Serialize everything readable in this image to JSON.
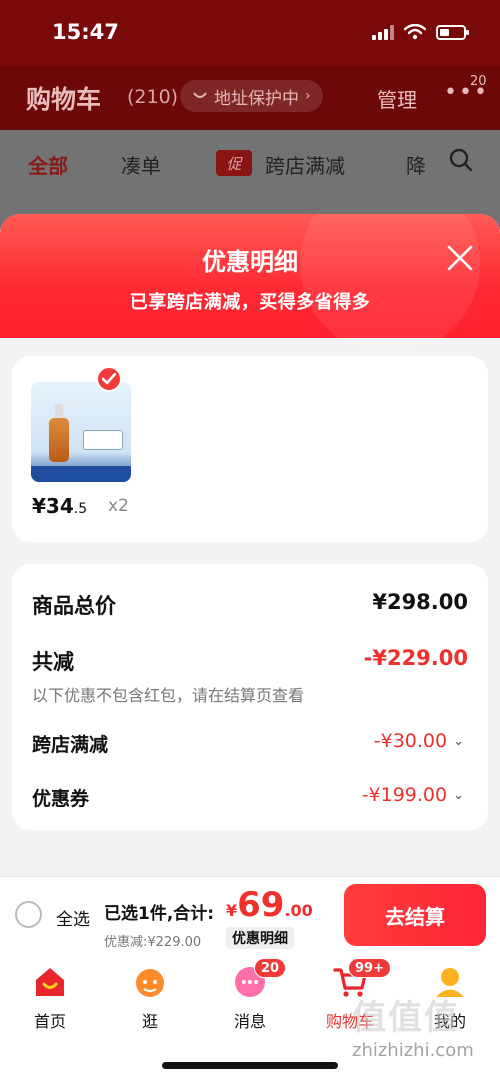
{
  "status_bar": {
    "time": "15:47"
  },
  "cart_header": {
    "title": "购物车",
    "count": "(210)",
    "address_pill": "地址保护中",
    "manage": "管理",
    "more_badge": "20"
  },
  "filter_tabs": {
    "all": "全部",
    "bundle": "凑单",
    "promo_tag": "促",
    "cross_store": "跨店满减",
    "price_drop": "降"
  },
  "sheet": {
    "title": "优惠明细",
    "subtitle": "已享跨店满减，买得多省得多",
    "product": {
      "price_main": "¥34",
      "price_decimal": ".5",
      "quantity": "x2"
    },
    "summary": {
      "total_label": "商品总价",
      "total_value": "¥298.00",
      "reduce_label": "共减",
      "reduce_value": "-¥229.00",
      "note": "以下优惠不包含红包，请在结算页查看",
      "rows": [
        {
          "label": "跨店满减",
          "value": "-¥30.00"
        },
        {
          "label": "优惠券",
          "value": "-¥199.00"
        }
      ]
    }
  },
  "settlement": {
    "select_all": "全选",
    "selected_text": "已选1件,合计:",
    "currency": "¥",
    "total_int": "69",
    "total_dec": ".00",
    "discount_text": "优惠减:¥229.00",
    "discount_detail": "优惠明细",
    "checkout": "去结算"
  },
  "tab_bar": {
    "tabs": [
      {
        "label": "首页"
      },
      {
        "label": "逛"
      },
      {
        "label": "消息",
        "badge": "20"
      },
      {
        "label": "购物车",
        "badge": "99+"
      },
      {
        "label": "我的"
      }
    ]
  },
  "watermark": {
    "text": "值值值",
    "url": "zhizhizhi.com"
  },
  "colors": {
    "accent": "#f0302c",
    "header_dark": "#6d0808"
  }
}
